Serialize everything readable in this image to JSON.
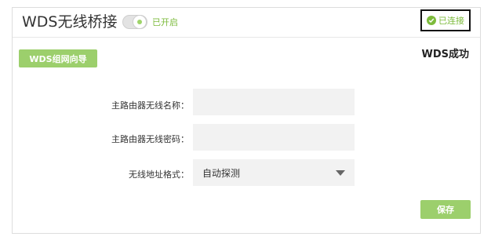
{
  "header": {
    "title": "WDS无线桥接",
    "toggle_state": "已开启",
    "connection_status": "已连接"
  },
  "wizard_button": "WDS组网向导",
  "wds_status": "WDS成功",
  "form": {
    "ssid_label": "主路由器无线名称：",
    "ssid_value": "",
    "password_label": "主路由器无线密码：",
    "password_value": "",
    "address_format_label": "无线地址格式：",
    "address_format_value": "自动探测"
  },
  "save_button": "保存",
  "colors": {
    "accent_green": "#9ccf6c",
    "status_green": "#7dbb3c"
  },
  "icons": {
    "connection": "check-circle-icon",
    "select": "caret-down-icon"
  }
}
